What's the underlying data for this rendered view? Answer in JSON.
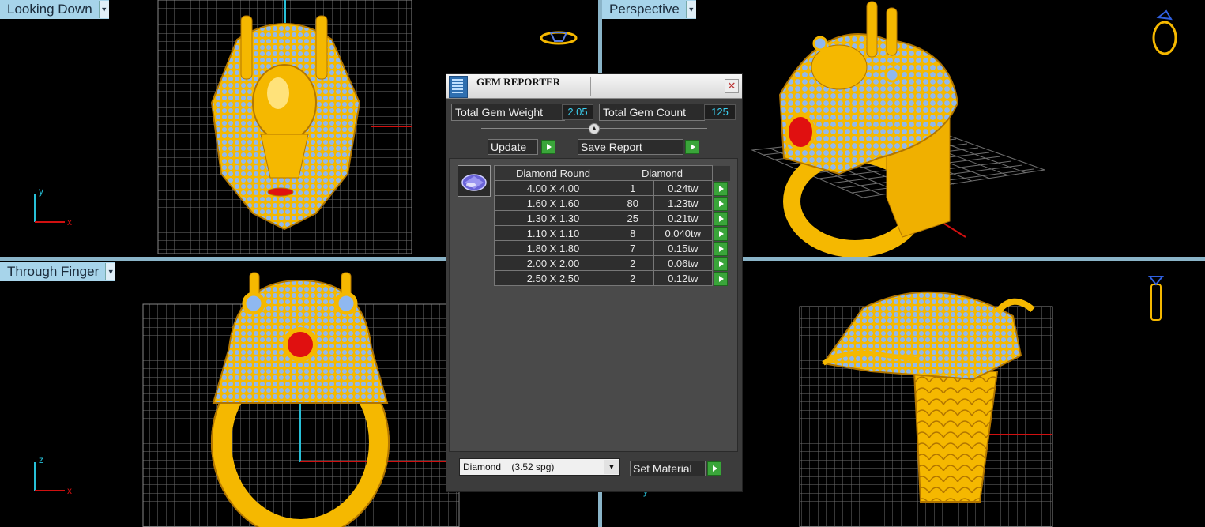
{
  "viewports": {
    "top_left": {
      "label": "Looking Down",
      "axis_y": "y",
      "axis_x": "x"
    },
    "top_right": {
      "label": "Perspective"
    },
    "bottom_left": {
      "label": "Through Finger",
      "axis_y": "z",
      "axis_x": "x"
    },
    "bottom_right": {
      "label": "",
      "axis_hint": "y"
    }
  },
  "gem_reporter": {
    "title": "GEM REPORTER",
    "close_icon": "close-icon",
    "total_weight_label": "Total Gem Weight",
    "total_weight_value": "2.05",
    "total_count_label": "Total Gem Count",
    "total_count_value": "125",
    "update_label": "Update",
    "save_report_label": "Save Report",
    "table": {
      "headers": [
        "Diamond Round",
        "Diamond"
      ],
      "rows": [
        {
          "size": "4.00 X 4.00",
          "count": "1",
          "weight": "0.24tw"
        },
        {
          "size": "1.60 X 1.60",
          "count": "80",
          "weight": "1.23tw"
        },
        {
          "size": "1.30 X 1.30",
          "count": "25",
          "weight": "0.21tw"
        },
        {
          "size": "1.10 X 1.10",
          "count": "8",
          "weight": "0.040tw"
        },
        {
          "size": "1.80 X 1.80",
          "count": "7",
          "weight": "0.15tw"
        },
        {
          "size": "2.00 X 2.00",
          "count": "2",
          "weight": "0.06tw"
        },
        {
          "size": "2.50 X 2.50",
          "count": "2",
          "weight": "0.12tw"
        }
      ]
    },
    "material_select": "Diamond    (3.52 spg)",
    "set_material_label": "Set Material"
  },
  "colors": {
    "gold": "#f5b800",
    "gold_dark": "#b27600",
    "diamond": "#8fb8f0",
    "ruby": "#e01010",
    "grid": "#6e6e6e",
    "axis_red": "#d01010",
    "axis_cyan": "#27c0d8",
    "tab_bg": "#a7d4ea",
    "value_cyan": "#3bd0f0"
  }
}
